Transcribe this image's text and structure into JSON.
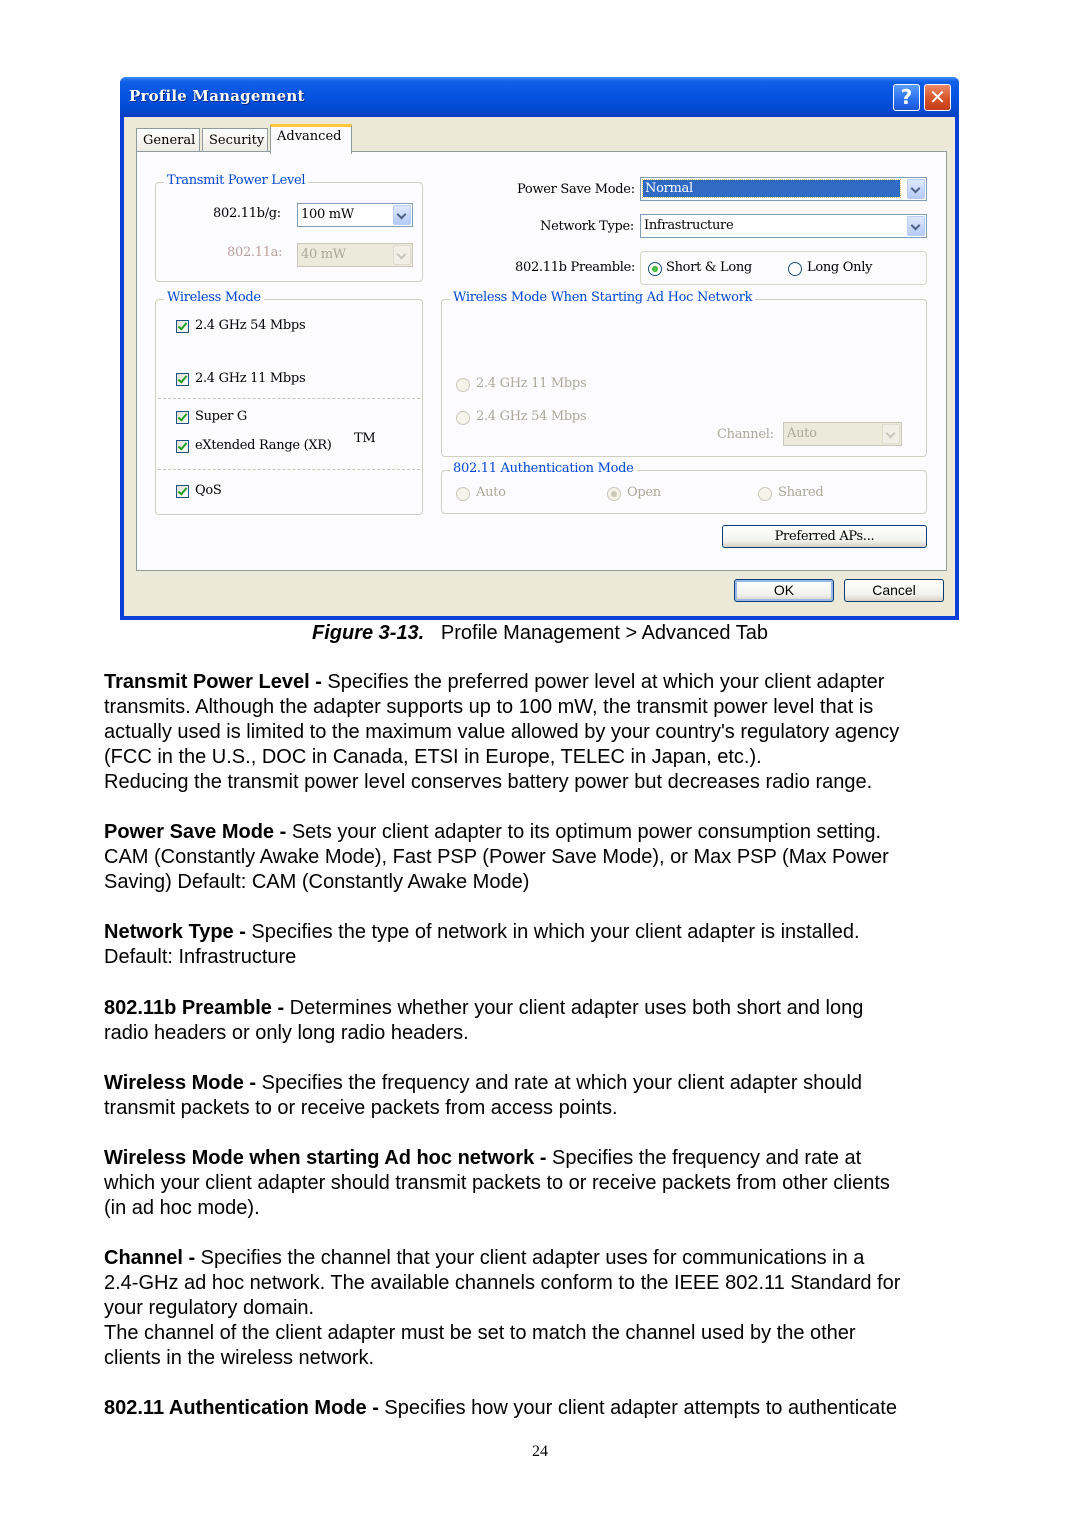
{
  "dialog": {
    "title": "Profile Management",
    "help_button": "?",
    "close_button": "✕",
    "tabs": [
      {
        "label": "General",
        "active": false
      },
      {
        "label": "Security",
        "active": false
      },
      {
        "label": "Advanced",
        "active": true
      }
    ],
    "transmit_power": {
      "legend": "Transmit Power Level",
      "bg_label": "802.11b/g:",
      "bg_value": "100 mW",
      "a_label": "802.11a:",
      "a_value": "40 mW",
      "a_enabled": false
    },
    "power_save": {
      "label": "Power Save Mode:",
      "value": "Normal"
    },
    "network_type": {
      "label": "Network Type:",
      "value": "Infrastructure"
    },
    "preamble": {
      "label": "802.11b Preamble:",
      "options": [
        {
          "label": "Short & Long",
          "checked": true
        },
        {
          "label": "Long Only",
          "checked": false
        }
      ]
    },
    "wireless_mode": {
      "legend": "Wireless Mode",
      "options": [
        {
          "label": "2.4 GHz 54 Mbps",
          "checked": true
        },
        {
          "label": "2.4 GHz 11 Mbps",
          "checked": true
        },
        {
          "label": "Super G",
          "checked": true
        },
        {
          "label": "eXtended Range (XR)",
          "checked": true
        },
        {
          "label": "QoS",
          "checked": true
        }
      ],
      "tm_mark": "TM"
    },
    "adhoc_mode": {
      "legend": "Wireless Mode When Starting Ad Hoc Network",
      "options": [
        {
          "label": "2.4 GHz 11 Mbps",
          "checked": false
        },
        {
          "label": "2.4 GHz 54 Mbps",
          "checked": false
        }
      ],
      "channel_label": "Channel:",
      "channel_value": "Auto",
      "enabled": false
    },
    "auth_mode": {
      "legend": "802.11 Authentication Mode",
      "options": [
        {
          "label": "Auto",
          "checked": false
        },
        {
          "label": "Open",
          "checked": true
        },
        {
          "label": "Shared",
          "checked": false
        }
      ],
      "enabled": false
    },
    "preferred_aps_button": "Preferred APs...",
    "ok_button": "OK",
    "cancel_button": "Cancel"
  },
  "caption": {
    "figure": "Figure 3-13.",
    "text": "Profile Management > Advanced Tab"
  },
  "paragraphs": [
    {
      "term": "Transmit Power Level -",
      "lines": [
        " Specifies the preferred power level at which your client adapter",
        "transmits. Although the adapter supports up to 100 mW, the transmit power level that is",
        "actually used is limited to the maximum value allowed by your country's regulatory agency",
        "(FCC in the U.S., DOC in Canada, ETSI in Europe, TELEC in Japan, etc.).",
        "Reducing the transmit power level conserves battery power but decreases radio range."
      ]
    },
    {
      "term": "Power Save Mode -",
      "lines": [
        " Sets your client adapter to its optimum power consumption setting.",
        "CAM (Constantly Awake Mode), Fast PSP (Power Save Mode), or Max PSP (Max Power",
        "Saving) Default: CAM (Constantly Awake Mode)"
      ]
    },
    {
      "term": "Network Type -",
      "lines": [
        " Specifies the type of network in which your client adapter is installed.",
        "Default: Infrastructure"
      ]
    },
    {
      "term": "802.11b Preamble -",
      "lines": [
        " Determines whether your client adapter uses both short and long",
        "radio headers or only long radio headers."
      ]
    },
    {
      "term": "Wireless Mode -",
      "lines": [
        " Specifies the frequency and rate at which your client adapter should",
        "transmit packets to or receive packets from access points."
      ]
    },
    {
      "term": "Wireless Mode when starting Ad hoc network -",
      "lines": [
        " Specifies the frequency and rate at",
        "which your client adapter should transmit packets to or receive packets from other clients",
        "(in ad hoc mode)."
      ]
    },
    {
      "term": "Channel -",
      "lines": [
        " Specifies the channel that your client adapter uses for communications in a",
        "2.4-GHz ad hoc network. The available channels conform to the IEEE 802.11 Standard for",
        "your regulatory domain.",
        "The channel of the client adapter must be set to match the channel used by the other",
        "clients in the wireless network."
      ]
    },
    {
      "term": "802.11 Authentication Mode -",
      "lines": [
        " Specifies how your client adapter attempts to authenticate"
      ]
    }
  ],
  "page_number": "24"
}
